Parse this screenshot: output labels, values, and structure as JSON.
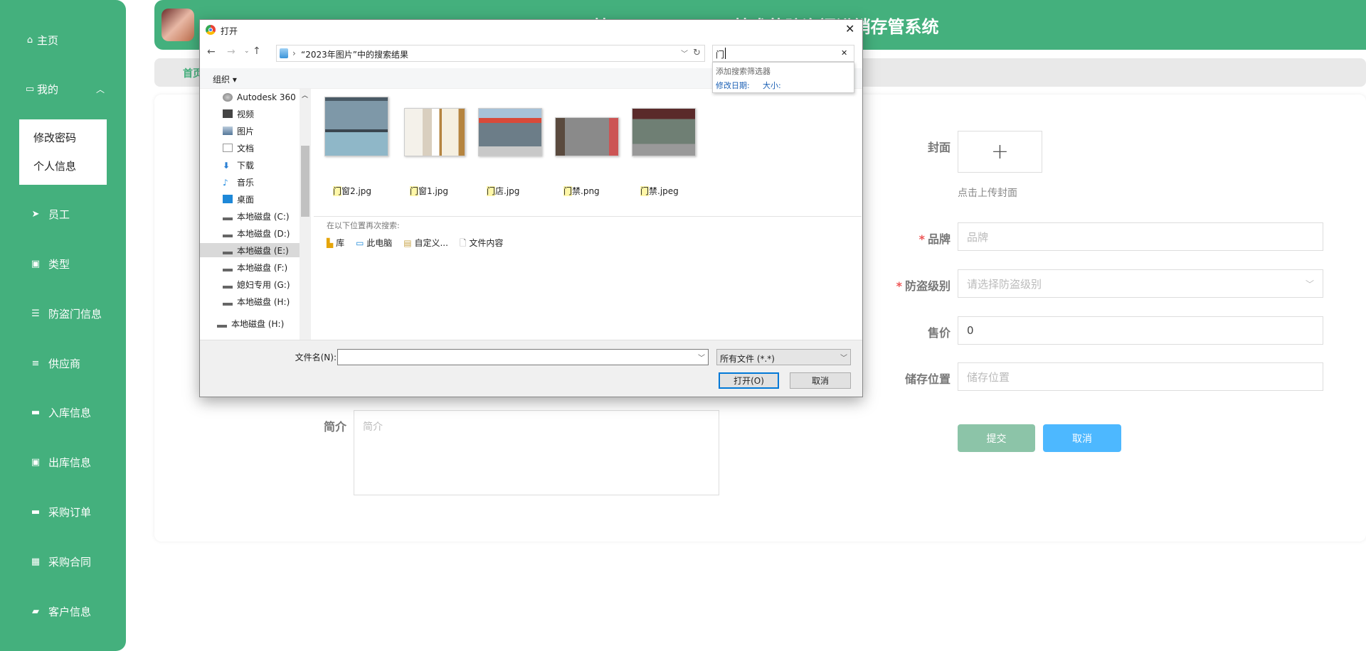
{
  "app": {
    "title": "基于SpringBoot技术的防盗门进销存管系统",
    "breadcrumb": "首页"
  },
  "sidebar": {
    "items": [
      {
        "label": "主页",
        "icon": "home-icon"
      },
      {
        "label": "我的",
        "icon": "card-icon"
      },
      {
        "label": "员工",
        "icon": "paper-plane-icon"
      },
      {
        "label": "类型",
        "icon": "chart-icon"
      },
      {
        "label": "防盗门信息",
        "icon": "sliders-icon"
      },
      {
        "label": "供应商",
        "icon": "list-icon"
      },
      {
        "label": "入库信息",
        "icon": "briefcase-icon"
      },
      {
        "label": "出库信息",
        "icon": "box-icon"
      },
      {
        "label": "采购订单",
        "icon": "message-icon"
      },
      {
        "label": "采购合同",
        "icon": "grid-icon"
      },
      {
        "label": "客户信息",
        "icon": "wallet-icon"
      }
    ],
    "submenu": [
      "修改密码",
      "个人信息"
    ]
  },
  "form": {
    "cover_label": "封面",
    "cover_hint": "点击上传封面",
    "brand_label": "品牌",
    "brand_placeholder": "品牌",
    "level_label": "防盗级别",
    "level_placeholder": "请选择防盗级别",
    "price_label": "售价",
    "price_value": "0",
    "location_label": "储存位置",
    "location_placeholder": "储存位置",
    "intro_label": "简介",
    "intro_placeholder": "简介",
    "submit": "提交",
    "cancel": "取消",
    "required_mark": "*"
  },
  "dialog": {
    "title": "打开",
    "address": "“2023年图片”中的搜索结果",
    "search_value": "门",
    "search_filter_title": "添加搜索筛选器",
    "search_filters": [
      "修改日期:",
      "大小:"
    ],
    "organize": "组织 ▾",
    "nav": [
      "Autodesk 360",
      "视频",
      "图片",
      "文档",
      "下载",
      "音乐",
      "桌面",
      "本地磁盘 (C:)",
      "本地磁盘 (D:)",
      "本地磁盘 (E:)",
      "本地磁盘 (F:)",
      "媳妇专用 (G:)",
      "本地磁盘 (H:)",
      "本地磁盘 (H:)"
    ],
    "files": [
      {
        "hl": "门",
        "rest": "窗2.jpg"
      },
      {
        "hl": "门",
        "rest": "窗1.jpg"
      },
      {
        "hl": "门",
        "rest": "店.jpg"
      },
      {
        "hl": "门",
        "rest": "禁.png"
      },
      {
        "hl": "门",
        "rest": "禁.jpeg"
      }
    ],
    "search_again": "在以下位置再次搜索:",
    "search_locations": [
      "库",
      "此电脑",
      "自定义...",
      "文件内容"
    ],
    "filename_label": "文件名(N):",
    "filename_value": "",
    "filetype": "所有文件 (*.*)",
    "open": "打开(O)",
    "cancel": "取消"
  },
  "colors": {
    "primary": "#44b07d",
    "submit": "#8cc4a8",
    "cancel": "#4db8ff"
  }
}
